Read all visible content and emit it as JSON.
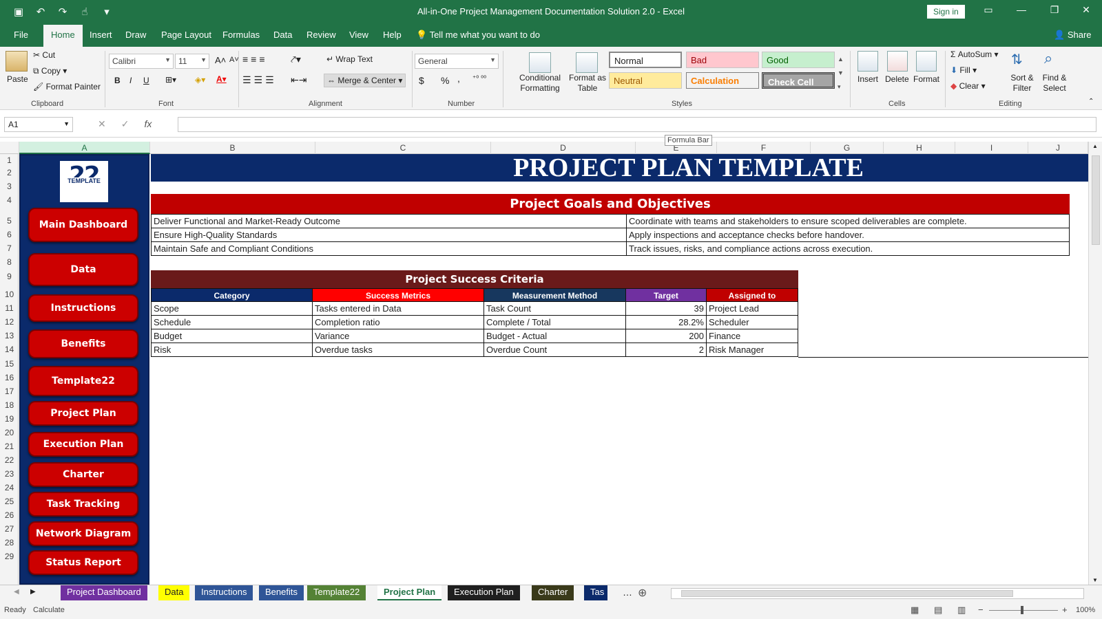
{
  "window": {
    "title": "All-in-One Project Management Documentation Solution 2.0  -  Excel",
    "sign_in": "Sign in",
    "minimize": "—",
    "restore": "❐",
    "close": "✕"
  },
  "ribbon_tabs": [
    "File",
    "Home",
    "Insert",
    "Draw",
    "Page Layout",
    "Formulas",
    "Data",
    "Review",
    "View",
    "Help"
  ],
  "tell_me": "Tell me what you want to do",
  "share": "Share",
  "clipboard": {
    "paste": "Paste",
    "cut": "Cut",
    "copy": "Copy",
    "format_painter": "Format Painter",
    "label": "Clipboard"
  },
  "font": {
    "name": "Calibri",
    "size": "11",
    "label": "Font",
    "bold": "B",
    "italic": "I",
    "underline": "U"
  },
  "alignment": {
    "wrap": "Wrap Text",
    "merge": "Merge & Center",
    "label": "Alignment"
  },
  "number": {
    "format": "General",
    "currency": "$",
    "percent": "%",
    "comma": ",",
    "label": "Number"
  },
  "styles": {
    "conditional": "Conditional Formatting",
    "format_table": "Format as Table",
    "normal": "Normal",
    "bad": "Bad",
    "good": "Good",
    "neutral": "Neutral",
    "calculation": "Calculation",
    "check": "Check Cell",
    "label": "Styles"
  },
  "cells": {
    "insert": "Insert",
    "delete": "Delete",
    "format": "Format",
    "label": "Cells"
  },
  "editing": {
    "autosum": "AutoSum",
    "fill": "Fill",
    "clear": "Clear",
    "sort": "Sort & Filter",
    "find": "Find & Select",
    "label": "Editing"
  },
  "formula_bar": {
    "name_box": "A1",
    "fx": "fx",
    "tooltip": "Formula Bar"
  },
  "columns": [
    "A",
    "B",
    "C",
    "D",
    "E",
    "F",
    "G",
    "H",
    "I",
    "J"
  ],
  "rows": [
    "1",
    "2",
    "3",
    "4",
    "5",
    "6",
    "7",
    "8",
    "9",
    "10",
    "11",
    "12",
    "13",
    "14",
    "15",
    "16",
    "17",
    "18",
    "19",
    "20",
    "21",
    "22",
    "23",
    "24",
    "25",
    "26",
    "27",
    "28",
    "29"
  ],
  "sidebar": {
    "logo_number": "22",
    "logo_word": "TEMPLATE",
    "buttons": [
      "Main Dashboard",
      "Data",
      "Instructions",
      "Benefits",
      "Template22",
      "Project Plan",
      "Execution Plan",
      "Charter",
      "Task Tracking",
      "Network Diagram",
      "Status Report"
    ]
  },
  "banner": "PROJECT PLAN TEMPLATE",
  "goals": {
    "title": "Project Goals and Objectives",
    "left": [
      "Deliver Functional and Market-Ready Outcome",
      "Ensure High-Quality Standards",
      "Maintain Safe and Compliant Conditions"
    ],
    "right": [
      "Coordinate with teams and stakeholders to ensure scoped deliverables are complete.",
      "Apply inspections and acceptance checks before handover.",
      "Track issues, risks, and compliance actions across execution."
    ]
  },
  "criteria": {
    "title": "Project Success Criteria",
    "headers": [
      "Category",
      "Success Metrics",
      "Measurement Method",
      "Target",
      "Assigned to"
    ],
    "header_colors": [
      "#0b2a6b",
      "#ff0000",
      "#17375e",
      "#7030a0",
      "#c00000"
    ],
    "rows": [
      [
        "Scope",
        "Tasks entered in Data",
        "Task Count",
        "39",
        "Project Lead"
      ],
      [
        "Schedule",
        "Completion ratio",
        "Complete / Total",
        "28.2%",
        "Scheduler"
      ],
      [
        "Budget",
        "Variance",
        "Budget - Actual",
        "200",
        "Finance"
      ],
      [
        "Risk",
        "Overdue tasks",
        "Overdue Count",
        "2",
        "Risk Manager"
      ]
    ]
  },
  "sheet_tabs": [
    {
      "label": "Project Dashboard",
      "color": "#7030a0"
    },
    {
      "label": "Data",
      "color": "#ffff00"
    },
    {
      "label": "Instructions",
      "color": "#2f5597"
    },
    {
      "label": "Benefits",
      "color": "#2f5597"
    },
    {
      "label": "Template22",
      "color": "#548235"
    },
    {
      "label": "Project Plan",
      "color": "#ffffff"
    },
    {
      "label": "Execution Plan",
      "color": "#1f1f1f"
    },
    {
      "label": "Charter",
      "color": "#3a3a1a"
    },
    {
      "label": "Tas",
      "color": "#0b2a6b"
    }
  ],
  "status": {
    "ready": "Ready",
    "calculate": "Calculate",
    "zoom": "100%"
  }
}
